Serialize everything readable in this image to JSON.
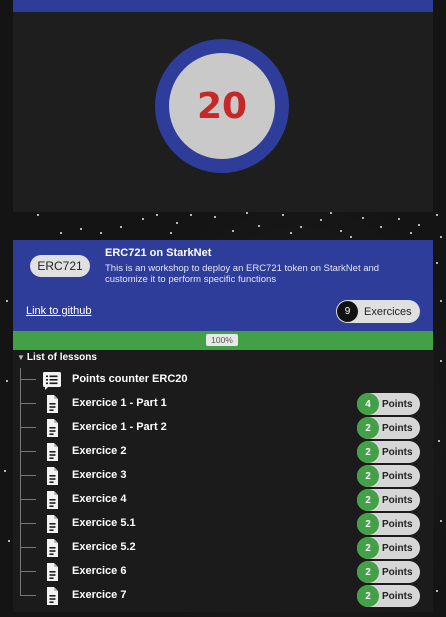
{
  "score": {
    "value": "20"
  },
  "lesson": {
    "tag": "ERC721",
    "title": "ERC721 on StarkNet",
    "description": "This is an workshop to deploy an ERC721 token on StarkNet and customize it to perform specific functions",
    "github_link": "Link to github",
    "exercises_count": "9",
    "exercises_label": "Exercices",
    "progress_percent": 100,
    "progress_label": "100%"
  },
  "list": {
    "header": "List of lessons",
    "items": [
      {
        "label": "Points counter ERC20",
        "icon": "list-document-icon"
      },
      {
        "label": "Exercice 1 - Part 1",
        "icon": "document-icon",
        "points": "4",
        "points_label": "Points"
      },
      {
        "label": "Exercice 1 - Part 2",
        "icon": "document-icon",
        "points": "2",
        "points_label": "Points"
      },
      {
        "label": "Exercice 2",
        "icon": "document-icon",
        "points": "2",
        "points_label": "Points"
      },
      {
        "label": "Exercice 3",
        "icon": "document-icon",
        "points": "2",
        "points_label": "Points"
      },
      {
        "label": "Exercice 4",
        "icon": "document-icon",
        "points": "2",
        "points_label": "Points"
      },
      {
        "label": "Exercice 5.1",
        "icon": "document-icon",
        "points": "2",
        "points_label": "Points"
      },
      {
        "label": "Exercice 5.2",
        "icon": "document-icon",
        "points": "2",
        "points_label": "Points"
      },
      {
        "label": "Exercice 6",
        "icon": "document-icon",
        "points": "2",
        "points_label": "Points"
      },
      {
        "label": "Exercice 7",
        "icon": "document-icon",
        "points": "2",
        "points_label": "Points"
      }
    ]
  },
  "colors": {
    "primary": "#2e3d9a",
    "success": "#43a047",
    "score_text": "#c62828",
    "background": "#141414"
  }
}
